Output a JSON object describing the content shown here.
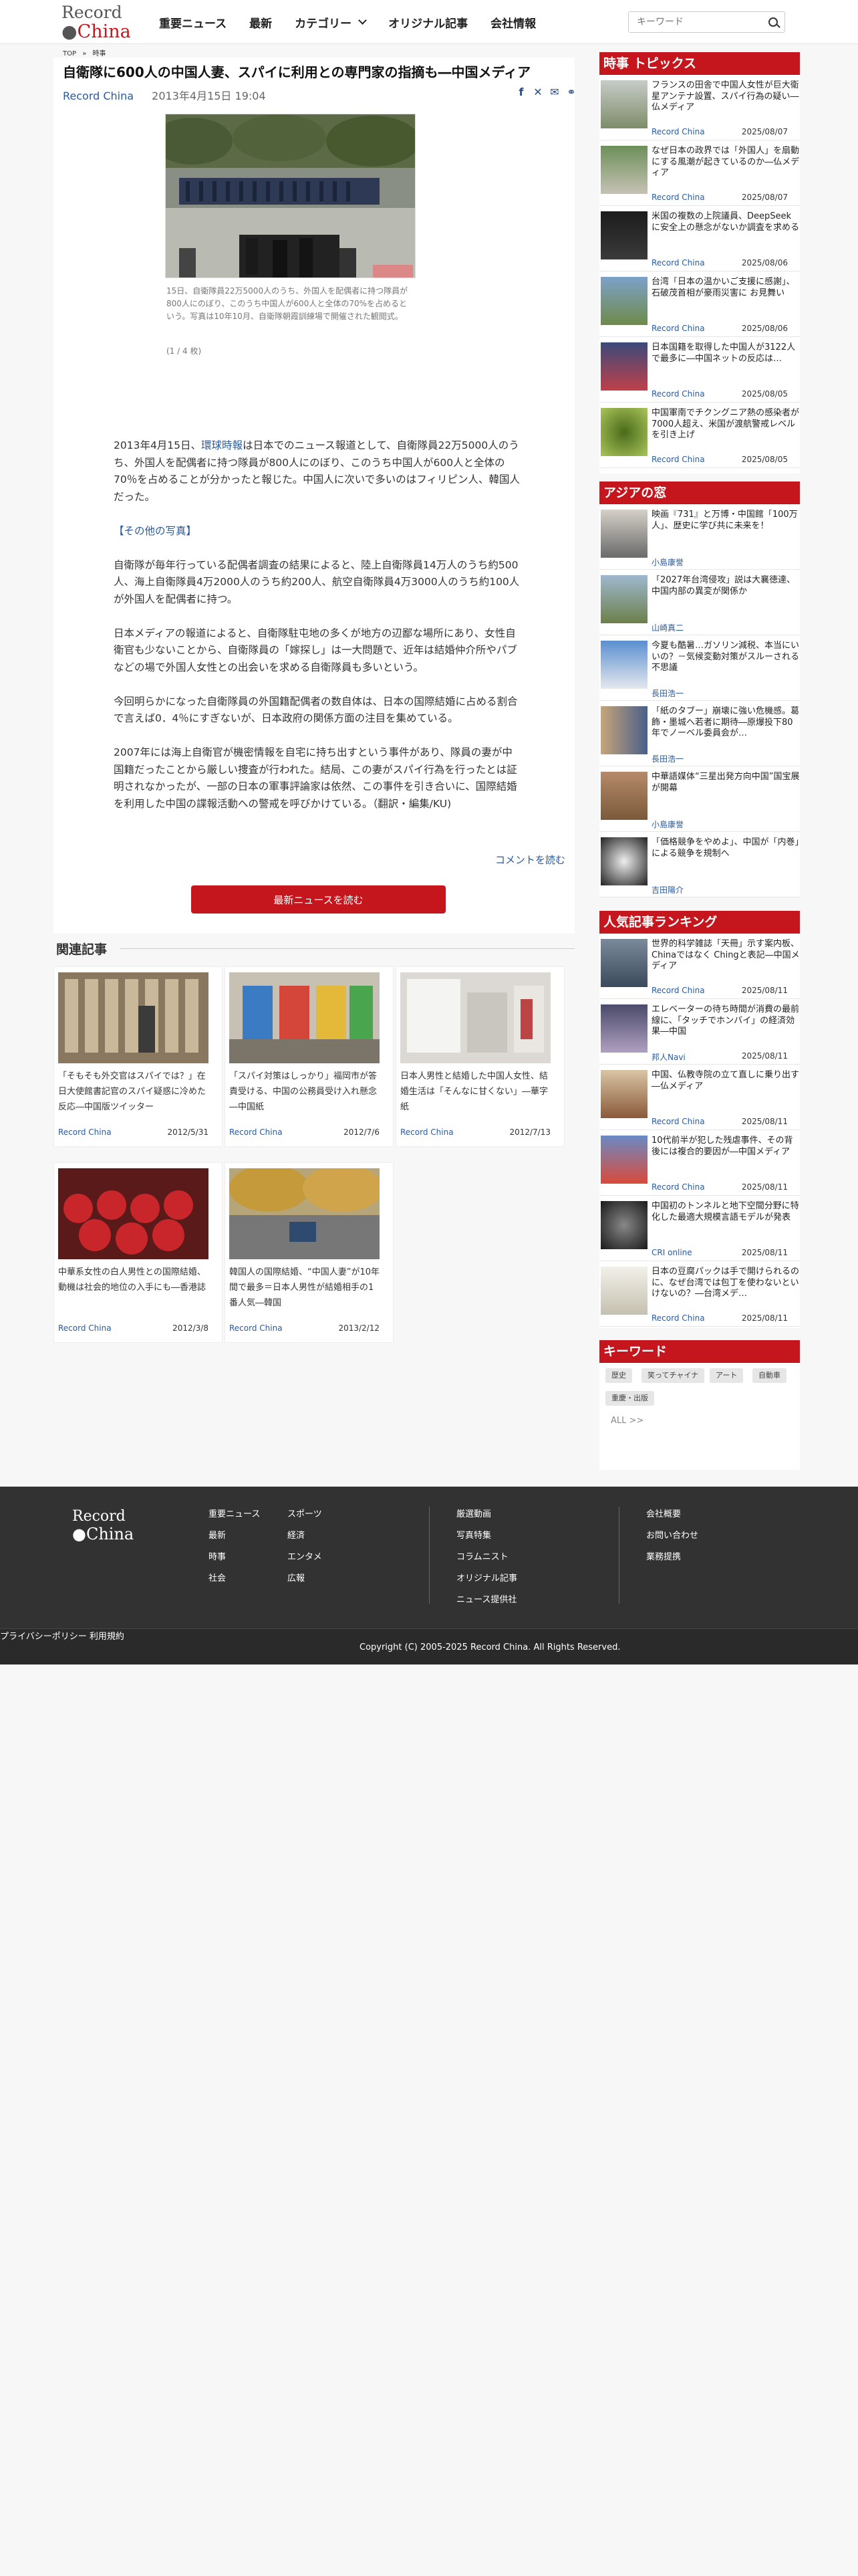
{
  "header": {
    "logo_top": "Record",
    "logo_bottom": "China",
    "nav": [
      "重要ニュース",
      "最新",
      "カテゴリー",
      "オリジナル記事",
      "会社情報"
    ],
    "search_placeholder": "キーワード"
  },
  "breadcrumb": {
    "top": "TOP",
    "sep": "»",
    "current": "時事"
  },
  "article": {
    "title": "自衛隊に600人の中国人妻、スパイに利用との専門家の指摘も―中国メディア",
    "source": "Record China",
    "datetime": "2013年4月15日 19:04",
    "caption": "15日、自衛隊員22万5000人のうち、外国人を配偶者に持つ隊員が800人にのぼり、このうち中国人が600人と全体の70%を占めるという。写真は10年10月、自衛隊朝霞訓練場で開催された観閲式。",
    "photo_count": "(1 / 4 枚)",
    "paragraphs": [
      "2013年4月15日、環球時報は日本でのニュース報道として、自衛隊員22万5000人のうち、外国人を配偶者に持つ隊員が800人にのぼり、このうち中国人が600人と全体の70％を占めることが分かったと報じた。中国人に次いで多いのはフィリピン人、韓国人だった。",
      "【その他の写真】",
      "自衛隊が毎年行っている配偶者調査の結果によると、陸上自衛隊員14万人のうち約500人、海上自衛隊員4万2000人のうち約200人、航空自衛隊員4万3000人のうち約100人が外国人を配偶者に持つ。",
      "日本メディアの報道によると、自衛隊駐屯地の多くが地方の辺鄙な場所にあり、女性自衛官も少ないことから、自衛隊員の「嫁探し」は一大問題で、近年は結婚仲介所やパブなどの場で外国人女性との出会いを求める自衛隊員も多いという。",
      "今回明らかになった自衛隊員の外国籍配偶者の数自体は、日本の国際結婚に占める割合で言えば0．4％にすぎないが、日本政府の関係方面の注目を集めている。",
      "2007年には海上自衛官が機密情報を自宅に持ち出すという事件があり、隊員の妻が中国籍だったことから厳しい捜査が行われた。結局、この妻がスパイ行為を行ったとは証明されなかったが、一部の日本の軍事評論家は依然、この事件を引き合いに、国際結婚を利用した中国の諜報活動への警戒を呼びかけている。（翻訳・編集/KU)"
    ],
    "link_word": "環球時報",
    "comment_link": "コメントを読む",
    "more_button": "最新ニュースを読む"
  },
  "related": {
    "heading": "関連記事",
    "cards": [
      {
        "title": "「そもそも外交官はスパイでは？」在日大使館書記官のスパイ疑惑に冷めた反応―中国版ツイッター",
        "source": "Record China",
        "date": "2012/5/31"
      },
      {
        "title": "「スパイ対策はしっかり」福岡市が答責受ける、中国の公務員受け入れ懸念―中国紙",
        "source": "Record China",
        "date": "2012/7/6"
      },
      {
        "title": "日本人男性と結婚した中国人女性、結婚生活は「そんなに甘くない」―華字紙",
        "source": "Record China",
        "date": "2012/7/13"
      },
      {
        "title": "中華系女性の白人男性との国際結婚、動機は社会的地位の入手にも―香港誌",
        "source": "Record China",
        "date": "2012/3/8"
      },
      {
        "title": "韓国人の国際結婚、“中国人妻”が10年間で最多＝日本人男性が結婚相手の1番人気―韓国",
        "source": "Record China",
        "date": "2013/2/12"
      }
    ]
  },
  "sidebar": {
    "topics_heading": "時事 トピックス",
    "topics": [
      {
        "title": "フランスの田舎で中国人女性が巨大衛星アンテナ設置、スパイ行為の疑い―仏メディア",
        "source": "Record China",
        "date": "2025/08/07"
      },
      {
        "title": "なぜ日本の政界では「外国人」を扇動にする風潮が起きているのか―仏メディア",
        "source": "Record China",
        "date": "2025/08/07"
      },
      {
        "title": "米国の複数の上院議員、DeepSeekに安全上の懸念がないか調査を求める",
        "source": "Record China",
        "date": "2025/08/06"
      },
      {
        "title": "台湾「日本の温かいご支援に感謝」、石破茂首相が豪雨災害に お見舞い",
        "source": "Record China",
        "date": "2025/08/06"
      },
      {
        "title": "日本国籍を取得した中国人が3122人で最多に―中国ネットの反応は…",
        "source": "Record China",
        "date": "2025/08/05"
      },
      {
        "title": "中国軍南でチクングニア熱の感染者が7000人超え、米国が渡航警戒レベルを引き上げ",
        "source": "Record China",
        "date": "2025/08/05"
      }
    ],
    "asia_heading": "アジアの窓",
    "asia": [
      {
        "title": "映画『731』と万博・中国館「100万人」、歴史に学び共に未来を！",
        "author": "小島康誉"
      },
      {
        "title": "「2027年台湾侵攻」説は大襄徳達、中国内部の異変が関係か",
        "author": "山崎真二"
      },
      {
        "title": "今夏も酷暑…ガソリン減税、本当にいいの？－気候変動対策がスルーされる不思議",
        "author": "長田浩一"
      },
      {
        "title": "「紙のタブー」崩壊に強い危機感。葛飾・墨城へ若者に期待―原爆投下80年でノーベル委員会が…",
        "author": "長田浩一"
      },
      {
        "title": "中華語媒体“三星出発方向中国”国宝展が開幕",
        "author": "小島康誉"
      },
      {
        "title": "「価格競争をやめよ」、中国が「内巻」による競争を規制へ",
        "author": "吉田陽介"
      }
    ],
    "ranking_heading": "人気記事ランキング",
    "ranking": [
      {
        "title": "世界的科学雑誌「天冊」示す案内板、Chinaではなく Chingと表記―中国メディア",
        "source": "Record China",
        "date": "2025/08/11"
      },
      {
        "title": "エレベーターの待ち時間が消費の最前線に、「タッチでホンバイ」の経済効果―中国",
        "source": "邦人Navi",
        "date": "2025/08/11"
      },
      {
        "title": "中国、仏教寺院の立て直しに乗り出す―仏メディア",
        "source": "Record China",
        "date": "2025/08/11"
      },
      {
        "title": "10代前半が犯した残虐事件、その背後には複合的要因が―中国メディア",
        "source": "Record China",
        "date": "2025/08/11"
      },
      {
        "title": "中国初のトンネルと地下空間分野に特化した最適大規模言語モデルが発表",
        "source": "CRI online",
        "date": "2025/08/11"
      },
      {
        "title": "日本の豆腐パックは手で開けられるのに、なぜ台湾では包丁を使わないといけないの？―台湾メデ…",
        "source": "Record China",
        "date": "2025/08/11"
      }
    ],
    "keyword_heading": "キーワード",
    "tags": [
      "歴史",
      "笑ってチャイナ",
      "アート",
      "自動車",
      "重慶・出版"
    ],
    "all_link": "ALL >>"
  },
  "footer": {
    "col1": [
      "重要ニュース",
      "最新",
      "時事",
      "社会"
    ],
    "col2": [
      "スポーツ",
      "経済",
      "エンタメ",
      "広報"
    ],
    "col3": [
      "厳選動画",
      "写真特集",
      "コラムニスト",
      "オリジナル記事",
      "ニュース提供社"
    ],
    "col4": [
      "会社概要",
      "お問い合わせ",
      "業務提携"
    ],
    "privacy": "プライバシーポリシー",
    "terms": "利用規約",
    "copyright": "Copyright (C) 2005-2025 Record China. All Rights Reserved."
  },
  "colors": {
    "brand_red": "#c4161c",
    "link_blue": "#2a5a9e",
    "footer_bg": "#323232"
  }
}
